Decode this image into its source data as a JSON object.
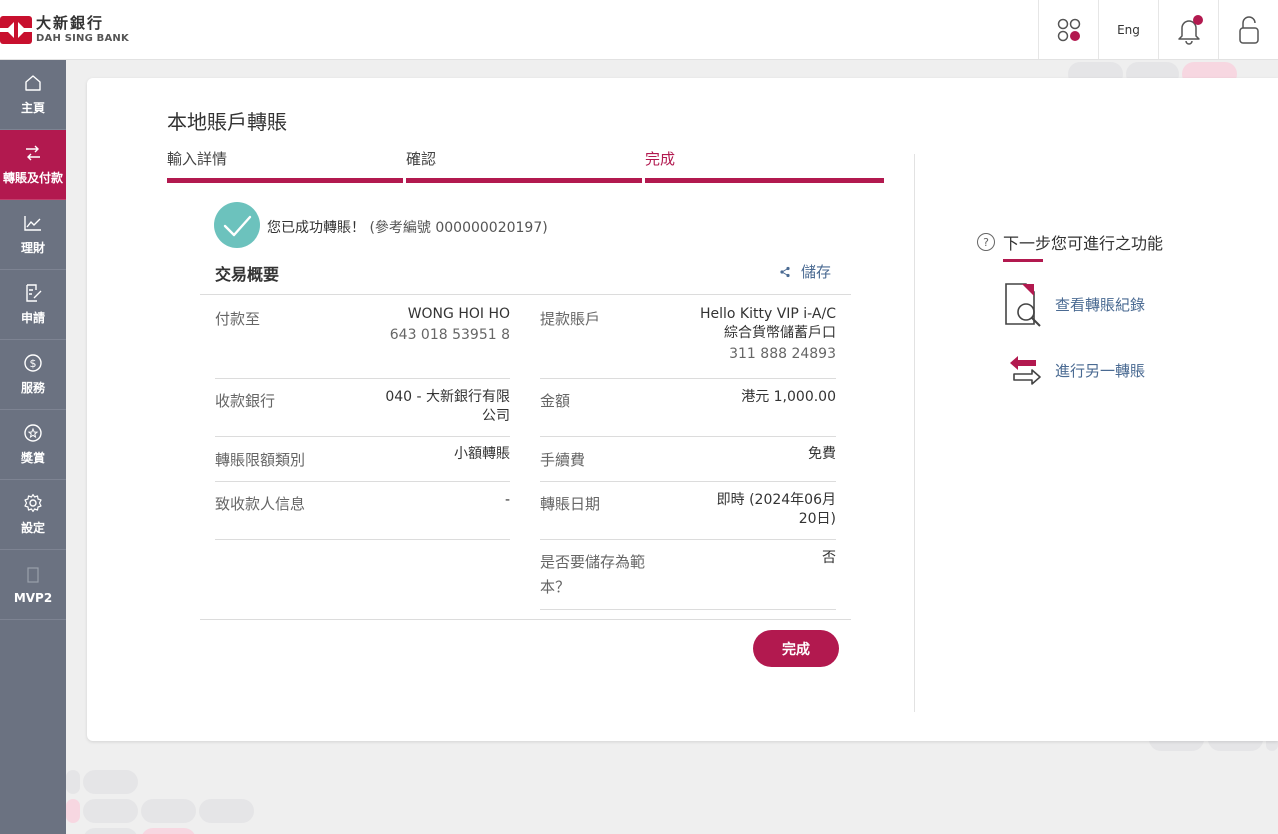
{
  "brand": {
    "name_zh": "大新銀行",
    "name_en": "DAH SING BANK",
    "accent": "#b2194f"
  },
  "header": {
    "lang_label": "Eng",
    "icons": [
      "apps-icon",
      "bell-icon",
      "lock-icon"
    ]
  },
  "sidebar": {
    "items": [
      {
        "label": "主頁",
        "icon": "home-icon"
      },
      {
        "label": "轉賬及付款",
        "icon": "transfer-icon"
      },
      {
        "label": "理財",
        "icon": "chart-icon"
      },
      {
        "label": "申請",
        "icon": "form-icon"
      },
      {
        "label": "服務",
        "icon": "dollar-icon"
      },
      {
        "label": "獎賞",
        "icon": "star-icon"
      },
      {
        "label": "設定",
        "icon": "gear-icon"
      },
      {
        "label": "MVP2",
        "icon": "doc-icon"
      }
    ]
  },
  "page": {
    "title": "本地賬戶轉賬"
  },
  "steps": [
    "輸入詳情",
    "確認",
    "完成"
  ],
  "success": {
    "message": "您已成功轉賬！",
    "reference": "(參考編號 000000020197)"
  },
  "summary": {
    "title": "交易概要",
    "save_label": "儲存",
    "left": {
      "payee_label": "付款至",
      "payee_name": "WONG HOI HO",
      "payee_account": "643 018 53951 8",
      "bank_label": "收款銀行",
      "bank_line1": "040 - 大新銀行有限",
      "bank_line2": "公司",
      "limit_label": "轉賬限額類別",
      "limit_value": "小額轉賬",
      "message_label": "致收款人信息",
      "message_value": "-"
    },
    "right": {
      "from_label": "提款賬戶",
      "from_line1": "Hello Kitty VIP i-A/C",
      "from_line2": "綜合貨幣儲蓄戶口",
      "from_account": "311 888 24893",
      "amount_label": "金額",
      "amount_value": "港元 1,000.00",
      "fee_label": "手續費",
      "fee_value": "免費",
      "date_label": "轉賬日期",
      "date_line1": "即時 (2024年06月",
      "date_line2": "20日)",
      "template_label_1": "是否要儲存為範",
      "template_label_2": "本？",
      "template_value": "否"
    }
  },
  "done_label": "完成",
  "next": {
    "title": "下一步您可進行之功能",
    "actions": [
      {
        "label": "查看轉賬紀錄",
        "icon": "search-document-icon"
      },
      {
        "label": "進行另一轉賬",
        "icon": "swap-arrows-icon"
      }
    ]
  }
}
